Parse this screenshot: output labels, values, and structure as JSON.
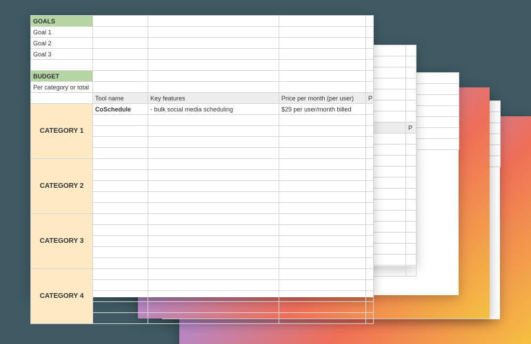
{
  "goals": {
    "header": "GOALS",
    "items": [
      "Goal 1",
      "Goal 2",
      "Goal 3"
    ]
  },
  "budget": {
    "header": "BUDGET",
    "note": "Per category or total"
  },
  "columns": {
    "tool": "Tool name",
    "features": "Key features",
    "price": "Price per month (per user)",
    "p_trunc": "P"
  },
  "row1": {
    "tool": "CoSchedule",
    "feature": "- bulk social media scheduling",
    "price": "$29 per user/month billed"
  },
  "categories": [
    "CATEGORY 1",
    "CATEGORY 2",
    "CATEGORY 3",
    "CATEGORY 4"
  ],
  "frag": {
    "price_head": "nth (per user)",
    "price_val": "/month billed",
    "p_trunc": "P"
  }
}
